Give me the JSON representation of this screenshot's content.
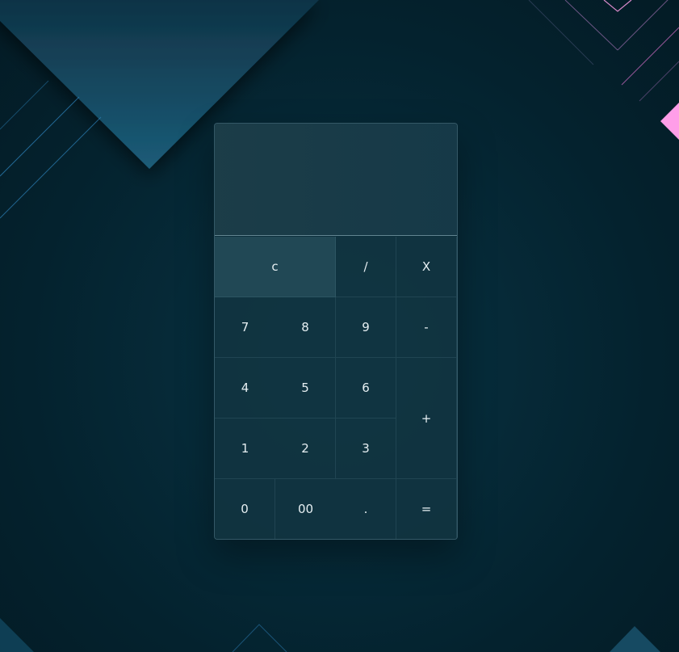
{
  "calculator": {
    "display_value": "",
    "keys": {
      "clear": "c",
      "divide": "/",
      "multiply": "X",
      "seven": "7",
      "eight": "8",
      "nine": "9",
      "minus": "-",
      "four": "4",
      "five": "5",
      "six": "6",
      "plus": "+",
      "one": "1",
      "two": "2",
      "three": "3",
      "zero": "0",
      "double_zero": "00",
      "decimal": ".",
      "equals": "="
    }
  },
  "colors": {
    "background": "#04222e",
    "triangle_fill": "#1b5c78",
    "accent_pink": "#ff9ee8",
    "line_blue": "#2b7bb0"
  }
}
